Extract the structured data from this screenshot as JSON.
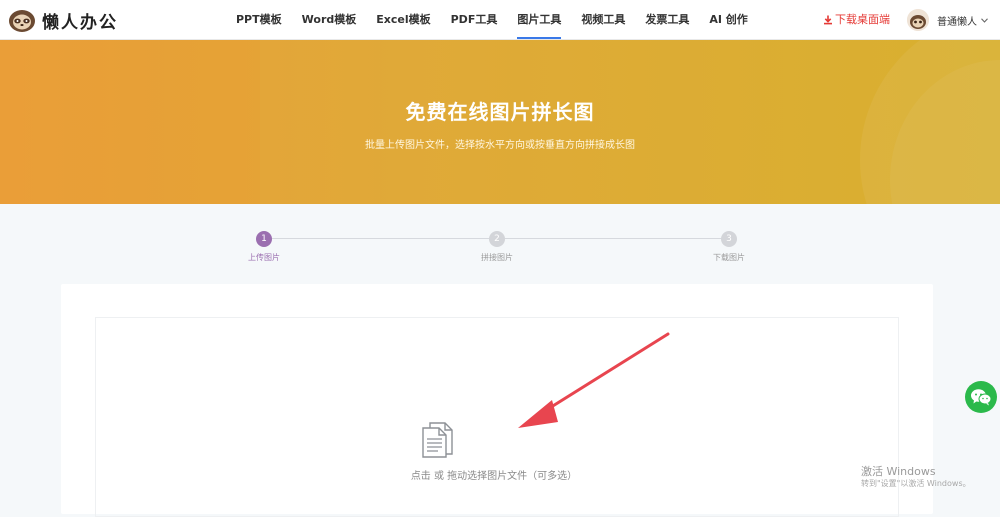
{
  "brand": {
    "name": "懒人办公"
  },
  "nav": [
    {
      "label": "PPT模板",
      "active": false
    },
    {
      "label": "Word模板",
      "active": false
    },
    {
      "label": "Excel模板",
      "active": false
    },
    {
      "label": "PDF工具",
      "active": false
    },
    {
      "label": "图片工具",
      "active": true
    },
    {
      "label": "视频工具",
      "active": false
    },
    {
      "label": "发票工具",
      "active": false
    },
    {
      "label": "AI 创作",
      "active": false
    }
  ],
  "header": {
    "download_label": "下载桌面端",
    "user_name": "普通懒人"
  },
  "banner": {
    "title": "免费在线图片拼长图",
    "subtitle": "批量上传图片文件，选择按水平方向或按垂直方向拼接成长图"
  },
  "steps": [
    {
      "num": "1",
      "label": "上传图片",
      "active": true
    },
    {
      "num": "2",
      "label": "拼接图片",
      "active": false
    },
    {
      "num": "3",
      "label": "下载图片",
      "active": false
    }
  ],
  "upload": {
    "hint": "点击 或 拖动选择图片文件（可多选）"
  },
  "watermark": {
    "title": "激活 Windows",
    "subtitle": "转到\"设置\"以激活 Windows。"
  },
  "colors": {
    "accent": "#3a79e8",
    "step_active": "#9b6fb0",
    "download": "#e53935",
    "wechat": "#2bb94b",
    "banner_start": "#e9a03b",
    "banner_end": "#d8b02f",
    "arrow": "#e8454f"
  },
  "icons": [
    "sloth-logo-icon",
    "download-icon",
    "user-avatar",
    "chevron-down-icon",
    "document-icon",
    "wechat-icon",
    "arrow-pointer"
  ]
}
